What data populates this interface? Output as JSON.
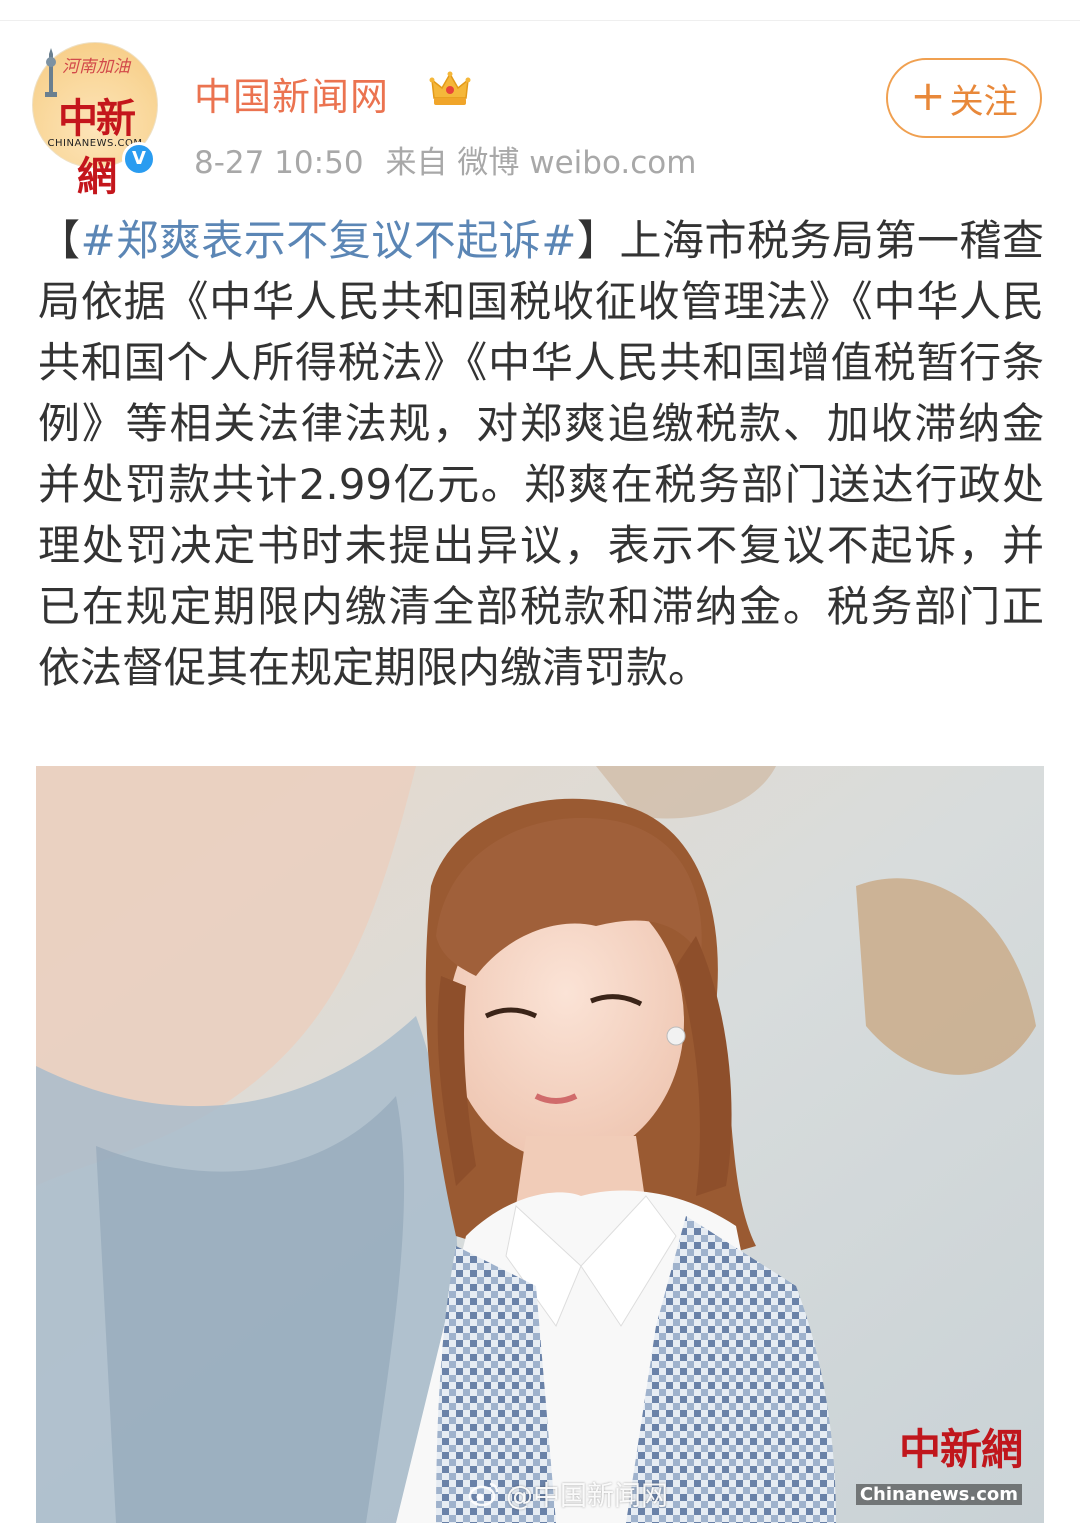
{
  "header": {
    "avatar": {
      "banner_text": "河南加油",
      "logo_text": "中新網",
      "sub_text": "CHINANEWS.COM",
      "verified_icon": "verified-v-icon",
      "verified_mark": "V"
    },
    "username": "中国新闻网",
    "member_icon": "crown-icon",
    "time": "8-27 10:50",
    "source": "来自 微博 weibo.com",
    "follow": {
      "plus": "+",
      "label": "关注"
    }
  },
  "post": {
    "text_before": "【",
    "hashtag": "#郑爽表示不复议不起诉#",
    "text_after": "】上海市税务局第一稽查局依据《中华人民共和国税收征收管理法》《中华人民共和国个人所得税法》《中华人民共和国增值税暂行条例》等相关法律法规，对郑爽追缴税款、加收滞纳金并处罚款共计2.99亿元。郑爽在税务部门送达行政处理处罚决定书时未提出异议，表示不复议不起诉，并已在规定期限内缴清全部税款和滞纳金。税务部门正依法督促其在规定期限内缴清罚款。"
  },
  "photo": {
    "watermark_logo": "中新網",
    "watermark_site": "Chinanews.com",
    "weibo_watermark": "@中国新闻网",
    "weibo_icon": "weibo-logo-icon"
  },
  "colors": {
    "username": "#eb7350",
    "hashtag": "#5b86b5",
    "follow_border": "#f0a050",
    "verified": "#2a9cf0"
  }
}
